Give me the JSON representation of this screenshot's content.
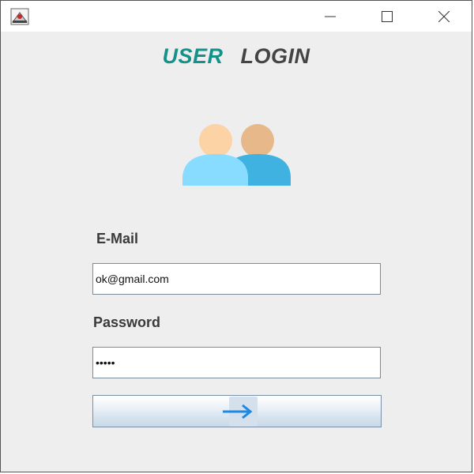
{
  "window": {
    "icon": "java-app-icon",
    "controls": {
      "minimize": "minimize-icon",
      "maximize": "maximize-icon",
      "close": "close-icon"
    }
  },
  "header": {
    "title_part1": "USER",
    "title_part2": "LOGIN",
    "accent_color": "#13928a"
  },
  "form": {
    "email_label": "E-Mail",
    "email_value": "ok@gmail.com",
    "password_label": "Password",
    "password_value": "•••••",
    "submit_icon": "arrow-right-icon"
  },
  "colors": {
    "person_front": "#87dcff",
    "person_back": "#3fb2e2",
    "head_front": "#fbd3a4",
    "head_back": "#e7b98a",
    "arrow": "#1e88e5"
  }
}
